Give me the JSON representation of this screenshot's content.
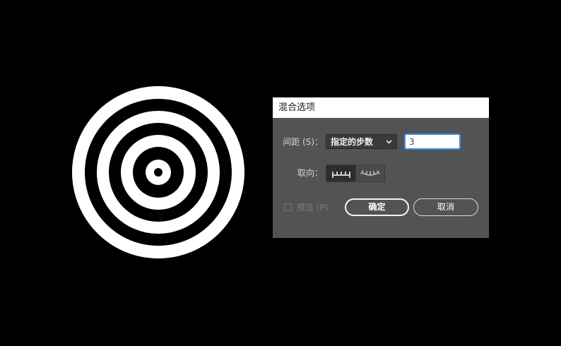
{
  "dialog": {
    "title": "混合选项",
    "spacing_label": "间距 (S)：",
    "spacing_select": {
      "selected": "指定的步数"
    },
    "steps_input": {
      "value": "3"
    },
    "orientation_label": "取向：",
    "orientation": {
      "options": [
        {
          "icon": "align-to-page-icon"
        },
        {
          "icon": "align-to-path-icon"
        }
      ],
      "selected": "align-to-page-icon"
    },
    "preview": {
      "label": "预览 (P)",
      "checked": false
    },
    "ok_button": "确定",
    "cancel_button": "取消"
  },
  "colors": {
    "canvas_background": "#000000",
    "dialog_background": "#535353",
    "titlebar_background": "#ffffff",
    "input_focus": "#3d8ee8",
    "artwork_light": "#ffffff",
    "artwork_dark": "#000000"
  }
}
